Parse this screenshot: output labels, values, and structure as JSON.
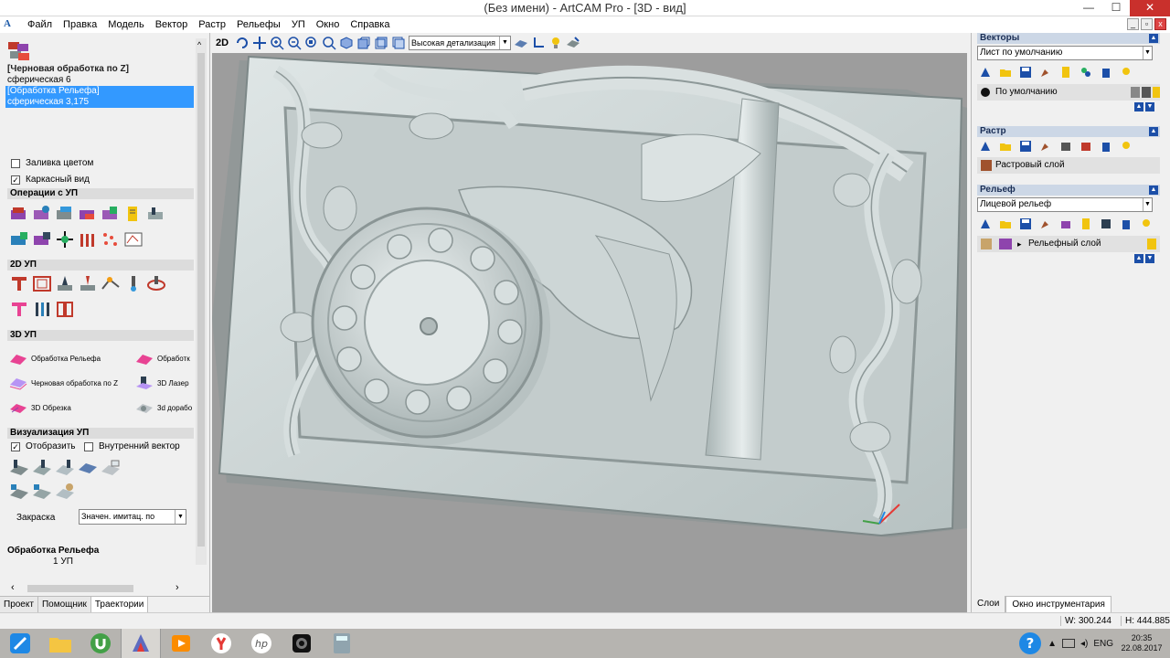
{
  "window": {
    "title": "(Без имени) - ArtCAM Pro - [3D - вид]"
  },
  "menu": [
    "Файл",
    "Правка",
    "Модель",
    "Вектор",
    "Растр",
    "Рельефы",
    "УП",
    "Окно",
    "Справка"
  ],
  "toolpaths": {
    "items": [
      {
        "label": "[Черновая обработка по Z]",
        "selected": false
      },
      {
        "label": "сферическая 6",
        "selected": false
      },
      {
        "label": "[Обработка Рельефа]",
        "selected": true
      },
      {
        "label": "сферическая 3,175",
        "selected": true
      }
    ],
    "fill_color": {
      "label": "Заливка цветом",
      "checked": false
    },
    "wireframe": {
      "label": "Каркасный вид",
      "checked": true
    }
  },
  "sections": {
    "ops": "Операции с УП",
    "ops2d": "2D УП",
    "ops3d": "3D УП",
    "viz": "Визуализация УП"
  },
  "ops3d_items": [
    "Обработка Рельефа",
    "Обработк",
    "Черновая обработка по Z",
    "3D Лазер",
    "3D Обрезка",
    "3d дорабо"
  ],
  "viz": {
    "show": {
      "label": "Отобразить",
      "checked": true
    },
    "inner_vector": {
      "label": "Внутренний вектор",
      "checked": false
    },
    "shading_label": "Закраска",
    "shading_value": "Значен. имитац. по"
  },
  "summary": {
    "title": "Обработка Рельефа",
    "count": "1 УП"
  },
  "left_tabs": [
    {
      "label": "Проект",
      "active": false
    },
    {
      "label": "Помощник",
      "active": false
    },
    {
      "label": "Траектории",
      "active": true
    }
  ],
  "toolbar": {
    "mode_2d": "2D",
    "detail": "Высокая детализация"
  },
  "vectors": {
    "header": "Векторы",
    "sheet": "Лист по умолчанию",
    "layer": "По умолчанию"
  },
  "raster": {
    "header": "Растр",
    "layer": "Растровый слой"
  },
  "relief": {
    "header": "Рельеф",
    "face": "Лицевой рельеф",
    "layer": "Рельефный слой"
  },
  "right_tabs": [
    {
      "label": "Слои",
      "active": false
    },
    {
      "label": "Окно инструментария",
      "active": true
    }
  ],
  "status": {
    "w": "W: 300.244",
    "h": "H: 444.885"
  },
  "taskbar": {
    "apps": [
      "toolbox-app",
      "file-explorer",
      "utorrent",
      "artcam",
      "media-player",
      "yandex-browser",
      "hp-app",
      "camera-app",
      "calculator"
    ],
    "lang": "ENG",
    "time": "20:35",
    "date": "22.08.2017"
  },
  "colors": {
    "selection": "#3399ff",
    "viewport_bg": "#9d9d9d",
    "relief": "#c5cfcf"
  }
}
